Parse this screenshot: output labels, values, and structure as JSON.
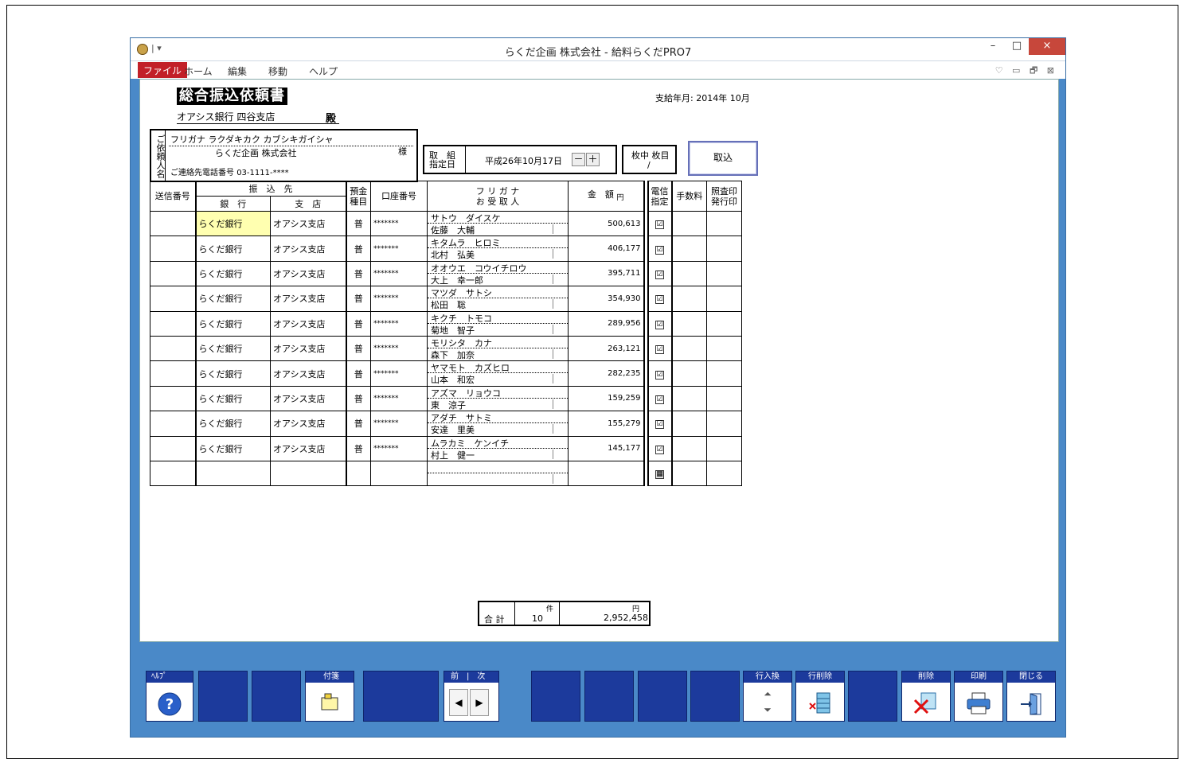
{
  "window": {
    "title": "らくだ企画 株式会社 - 給料らくだPRO7",
    "qat": "| ▾",
    "controls": {
      "minimize": "–",
      "maximize": "□",
      "close": "×"
    }
  },
  "menu": {
    "file": "ファイル",
    "items": [
      "ホーム",
      "編集",
      "移動",
      "ヘルプ"
    ],
    "right_icons": "♡ ▭ 🗗 ⊠"
  },
  "document": {
    "title": "総合振込依頼書",
    "bank": "オアシス銀行 四谷支店",
    "dono": "殿",
    "pay_month_label": "支給年月:",
    "pay_month": "2014年 10月"
  },
  "requester": {
    "vertical_label": "ご依頼人名",
    "furigana_label": "フリガナ",
    "furigana": "ラクダキカク カブシキガイシャ",
    "name": "らくだ企画 株式会社",
    "sama": "様",
    "phone_label": "ご連絡先電話番号",
    "phone": "03-1111-****"
  },
  "date": {
    "label_1": "取　組",
    "label_2": "指定日",
    "value": "平成26年10月17日",
    "minus": "－",
    "plus": "＋"
  },
  "pages": {
    "label": "枚中 枚目",
    "sep": "/"
  },
  "load_button": "取込",
  "table": {
    "headers": {
      "send_no": "送信番号",
      "transfer_to": "振　込　先",
      "bank": "銀　行",
      "branch": "支　店",
      "deposit_type_1": "預金",
      "deposit_type_2": "種目",
      "account_no": "口座番号",
      "furigana": "フ リ ガ ナ",
      "recipient": "お 受 取 人",
      "amount": "金　額",
      "yen": "円",
      "wire_1": "電信",
      "wire_2": "指定",
      "fee": "手数料",
      "receipt_1": "照査印",
      "receipt_2": "発行印"
    },
    "rows": [
      {
        "bank": "らくだ銀行",
        "branch": "オアシス支店",
        "type": "普",
        "account": "*******",
        "kana": "サトウ　ダイスケ",
        "name": "佐藤　大輔",
        "amount": "500,613",
        "wire": "☑"
      },
      {
        "bank": "らくだ銀行",
        "branch": "オアシス支店",
        "type": "普",
        "account": "*******",
        "kana": "キタムラ　ヒロミ",
        "name": "北村　弘美",
        "amount": "406,177",
        "wire": "☑"
      },
      {
        "bank": "らくだ銀行",
        "branch": "オアシス支店",
        "type": "普",
        "account": "*******",
        "kana": "オオウエ　コウイチロウ",
        "name": "大上　幸一郎",
        "amount": "395,711",
        "wire": "☑"
      },
      {
        "bank": "らくだ銀行",
        "branch": "オアシス支店",
        "type": "普",
        "account": "*******",
        "kana": "マツダ　サトシ",
        "name": "松田　聡",
        "amount": "354,930",
        "wire": "☑"
      },
      {
        "bank": "らくだ銀行",
        "branch": "オアシス支店",
        "type": "普",
        "account": "*******",
        "kana": "キクチ　トモコ",
        "name": "菊地　智子",
        "amount": "289,956",
        "wire": "☑"
      },
      {
        "bank": "らくだ銀行",
        "branch": "オアシス支店",
        "type": "普",
        "account": "*******",
        "kana": "モリシタ　カナ",
        "name": "森下　加奈",
        "amount": "263,121",
        "wire": "☑"
      },
      {
        "bank": "らくだ銀行",
        "branch": "オアシス支店",
        "type": "普",
        "account": "*******",
        "kana": "ヤマモト　カズヒロ",
        "name": "山本　和宏",
        "amount": "282,235",
        "wire": "☑"
      },
      {
        "bank": "らくだ銀行",
        "branch": "オアシス支店",
        "type": "普",
        "account": "*******",
        "kana": "アズマ　リョウコ",
        "name": "東　涼子",
        "amount": "159,259",
        "wire": "☑"
      },
      {
        "bank": "らくだ銀行",
        "branch": "オアシス支店",
        "type": "普",
        "account": "*******",
        "kana": "アダチ　サトミ",
        "name": "安達　里美",
        "amount": "155,279",
        "wire": "☑"
      },
      {
        "bank": "らくだ銀行",
        "branch": "オアシス支店",
        "type": "普",
        "account": "*******",
        "kana": "ムラカミ　ケンイチ",
        "name": "村上　健一",
        "amount": "145,177",
        "wire": "☑"
      },
      {
        "bank": "",
        "branch": "",
        "type": "",
        "account": "",
        "kana": "",
        "name": "",
        "amount": "",
        "wire": "▦"
      }
    ]
  },
  "total": {
    "label": "合 計",
    "count": "10",
    "count_unit": "件",
    "amount": "2,952,458",
    "amount_unit": "円"
  },
  "toolbar": {
    "help": "ﾍﾙﾌﾟ",
    "sticky": "付箋",
    "prev": "前",
    "next": "次",
    "row_swap": "行入換",
    "row_delete": "行削除",
    "delete": "削除",
    "print": "印刷",
    "close": "閉じる"
  }
}
